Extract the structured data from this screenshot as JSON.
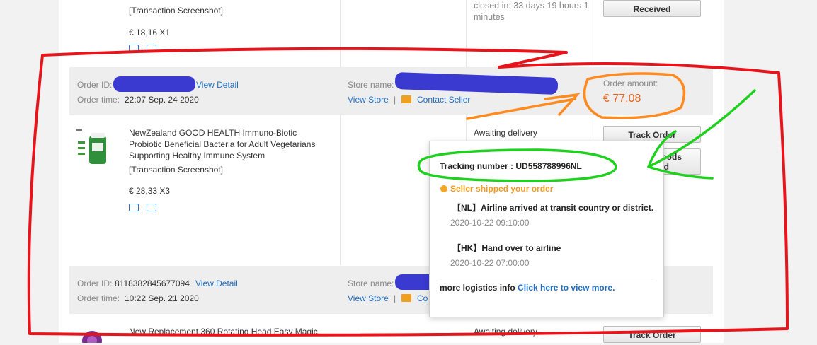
{
  "top_order": {
    "tag": "[Transaction Screenshot]",
    "price": "€ 18,16 X1",
    "status": "closed in: 33 days 19 hours 1 minutes",
    "button": "Received"
  },
  "order1": {
    "id_label": "Order ID:",
    "view_detail": "View Detail",
    "time_label": "Order time:",
    "time": "22:07 Sep. 24 2020",
    "store_label": "Store name:",
    "view_store": "View Store",
    "separator": "|",
    "contact_seller": "Contact Seller",
    "amount_label": "Order amount:",
    "amount": "€ 77,08",
    "product_title": "NewZealand GOOD HEALTH Immuno-Biotic Probiotic Beneficial Bacteria for Adult Vegetarians Supporting Healthy Immune System",
    "tag": "[Transaction Screenshot]",
    "price": "€ 28,33 X3",
    "status": "Awaiting delivery",
    "track_button": "Track Order",
    "confirm_button_part1": "oods",
    "confirm_button_part2": "ed"
  },
  "tracking_popup": {
    "tracking_label": "Tracking number : UD558788996NL",
    "shipped_status": "Seller shipped your order",
    "events": [
      {
        "text": "【NL】Airline arrived at transit country or district.",
        "time": "2020-10-22 09:10:00"
      },
      {
        "text": "【HK】Hand over to airline",
        "time": "2020-10-22 07:00:00"
      }
    ],
    "more_info": "more logistics info",
    "more_link": "Click here to view more."
  },
  "order2": {
    "id_label": "Order ID:",
    "id": "8118382845677094",
    "view_detail": "View Detail",
    "time_label": "Order time:",
    "time": "10:22 Sep. 21 2020",
    "store_label": "Store name:",
    "view_store": "View Store",
    "separator": "|",
    "contact_short": "Co"
  },
  "order3": {
    "product_title": "New Replacement 360 Rotating Head Easy Magic",
    "status": "Awaiting delivery",
    "track_button": "Track Order"
  },
  "colors": {
    "accent_orange": "#e8611a",
    "link_blue": "#1e6fc4",
    "annotation_red": "#e8141c",
    "annotation_green": "#1fd01f",
    "annotation_orange": "#ff8a1f",
    "redaction_blue": "#3a3ad0"
  },
  "icons": [
    "truck-icon",
    "return-icon",
    "mail-icon",
    "status-dot-icon"
  ]
}
